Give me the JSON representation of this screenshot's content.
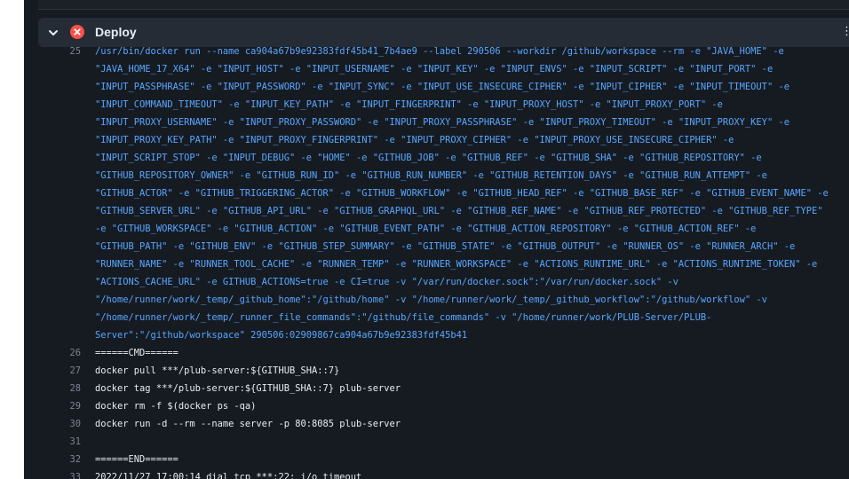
{
  "step": {
    "title": "Deploy",
    "status": "failed",
    "icons": {
      "toggle": "chevron-down-icon",
      "status": "x-circle-fill-icon",
      "menu": "kebab-icon"
    },
    "menu_glyph": "⋮"
  },
  "colors": {
    "panel_bg": "#161b22",
    "header_bg": "#262c36",
    "command": "#58a6ff",
    "text": "#e6edf3",
    "line_number": "#7d8590",
    "error": "#f85149"
  },
  "log": {
    "lines": [
      {
        "num": "25",
        "text": "/usr/bin/docker run --name ca904a67b9e92383fdf45b41_7b4ae9 --label 290506 --workdir /github/workspace --rm -e \"JAVA_HOME\" -e",
        "kind": "cmd"
      },
      {
        "num": "",
        "text": "\"JAVA_HOME_17_X64\" -e \"INPUT_HOST\" -e \"INPUT_USERNAME\" -e \"INPUT_KEY\" -e \"INPUT_ENVS\" -e \"INPUT_SCRIPT\" -e \"INPUT_PORT\" -e",
        "kind": "cmd"
      },
      {
        "num": "",
        "text": "\"INPUT_PASSPHRASE\" -e \"INPUT_PASSWORD\" -e \"INPUT_SYNC\" -e \"INPUT_USE_INSECURE_CIPHER\" -e \"INPUT_CIPHER\" -e \"INPUT_TIMEOUT\" -e",
        "kind": "cmd"
      },
      {
        "num": "",
        "text": "\"INPUT_COMMAND_TIMEOUT\" -e \"INPUT_KEY_PATH\" -e \"INPUT_FINGERPRINT\" -e \"INPUT_PROXY_HOST\" -e \"INPUT_PROXY_PORT\" -e",
        "kind": "cmd"
      },
      {
        "num": "",
        "text": "\"INPUT_PROXY_USERNAME\" -e \"INPUT_PROXY_PASSWORD\" -e \"INPUT_PROXY_PASSPHRASE\" -e \"INPUT_PROXY_TIMEOUT\" -e \"INPUT_PROXY_KEY\" -e",
        "kind": "cmd"
      },
      {
        "num": "",
        "text": "\"INPUT_PROXY_KEY_PATH\" -e \"INPUT_PROXY_FINGERPRINT\" -e \"INPUT_PROXY_CIPHER\" -e \"INPUT_PROXY_USE_INSECURE_CIPHER\" -e",
        "kind": "cmd"
      },
      {
        "num": "",
        "text": "\"INPUT_SCRIPT_STOP\" -e \"INPUT_DEBUG\" -e \"HOME\" -e \"GITHUB_JOB\" -e \"GITHUB_REF\" -e \"GITHUB_SHA\" -e \"GITHUB_REPOSITORY\" -e",
        "kind": "cmd"
      },
      {
        "num": "",
        "text": "\"GITHUB_REPOSITORY_OWNER\" -e \"GITHUB_RUN_ID\" -e \"GITHUB_RUN_NUMBER\" -e \"GITHUB_RETENTION_DAYS\" -e \"GITHUB_RUN_ATTEMPT\" -e",
        "kind": "cmd"
      },
      {
        "num": "",
        "text": "\"GITHUB_ACTOR\" -e \"GITHUB_TRIGGERING_ACTOR\" -e \"GITHUB_WORKFLOW\" -e \"GITHUB_HEAD_REF\" -e \"GITHUB_BASE_REF\" -e \"GITHUB_EVENT_NAME\" -e",
        "kind": "cmd"
      },
      {
        "num": "",
        "text": "\"GITHUB_SERVER_URL\" -e \"GITHUB_API_URL\" -e \"GITHUB_GRAPHQL_URL\" -e \"GITHUB_REF_NAME\" -e \"GITHUB_REF_PROTECTED\" -e \"GITHUB_REF_TYPE\"",
        "kind": "cmd"
      },
      {
        "num": "",
        "text": "-e \"GITHUB_WORKSPACE\" -e \"GITHUB_ACTION\" -e \"GITHUB_EVENT_PATH\" -e \"GITHUB_ACTION_REPOSITORY\" -e \"GITHUB_ACTION_REF\" -e",
        "kind": "cmd"
      },
      {
        "num": "",
        "text": "\"GITHUB_PATH\" -e \"GITHUB_ENV\" -e \"GITHUB_STEP_SUMMARY\" -e \"GITHUB_STATE\" -e \"GITHUB_OUTPUT\" -e \"RUNNER_OS\" -e \"RUNNER_ARCH\" -e",
        "kind": "cmd"
      },
      {
        "num": "",
        "text": "\"RUNNER_NAME\" -e \"RUNNER_TOOL_CACHE\" -e \"RUNNER_TEMP\" -e \"RUNNER_WORKSPACE\" -e \"ACTIONS_RUNTIME_URL\" -e \"ACTIONS_RUNTIME_TOKEN\" -e",
        "kind": "cmd"
      },
      {
        "num": "",
        "text": "\"ACTIONS_CACHE_URL\" -e GITHUB_ACTIONS=true -e CI=true -v \"/var/run/docker.sock\":\"/var/run/docker.sock\" -v",
        "kind": "cmd"
      },
      {
        "num": "",
        "text": "\"/home/runner/work/_temp/_github_home\":\"/github/home\" -v \"/home/runner/work/_temp/_github_workflow\":\"/github/workflow\" -v",
        "kind": "cmd"
      },
      {
        "num": "",
        "text": "\"/home/runner/work/_temp/_runner_file_commands\":\"/github/file_commands\" -v \"/home/runner/work/PLUB-Server/PLUB-",
        "kind": "cmd"
      },
      {
        "num": "",
        "text": "Server\":\"/github/workspace\" 290506:02909867ca904a67b9e92383fdf45b41",
        "kind": "cmd"
      },
      {
        "num": "26",
        "text": "======CMD======",
        "kind": "text"
      },
      {
        "num": "27",
        "text": "docker pull ***/plub-server:${GITHUB_SHA::7}",
        "kind": "text"
      },
      {
        "num": "28",
        "text": "docker tag ***/plub-server:${GITHUB_SHA::7} plub-server",
        "kind": "text"
      },
      {
        "num": "29",
        "text": "docker rm -f $(docker ps -qa)",
        "kind": "text"
      },
      {
        "num": "30",
        "text": "docker run -d --rm --name server -p 80:8085 plub-server",
        "kind": "text"
      },
      {
        "num": "31",
        "text": "",
        "kind": "text"
      },
      {
        "num": "32",
        "text": "======END======",
        "kind": "text"
      },
      {
        "num": "33",
        "text": "2022/11/27 17:00:14 dial tcp ***:22: i/o timeout",
        "kind": "text"
      }
    ]
  }
}
